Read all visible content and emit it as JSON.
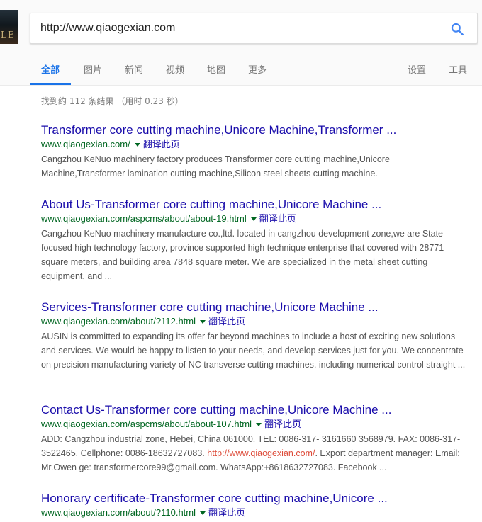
{
  "search": {
    "query": "http://www.qiaogexian.com"
  },
  "logo": {
    "letters": "LE"
  },
  "tabs": {
    "all": "全部",
    "images": "图片",
    "news": "新闻",
    "videos": "视频",
    "maps": "地图",
    "more": "更多",
    "settings": "设置",
    "tools": "工具"
  },
  "stats": "找到约 112 条结果 （用时 0.23 秒）",
  "translate_label": "翻译此页",
  "results": [
    {
      "title": "Transformer core cutting machine,Unicore Machine,Transformer ...",
      "url": "www.qiaogexian.com/",
      "snippet": "Cangzhou KeNuo machinery factory produces Transformer core cutting machine,Unicore Machine,Transformer lamination cutting machine,Silicon steel sheets cutting machine."
    },
    {
      "title": "About Us-Transformer core cutting machine,Unicore Machine ...",
      "url": "www.qiaogexian.com/aspcms/about/about-19.html",
      "snippet": "Cangzhou KeNuo machinery manufacture co.,ltd. located in cangzhou development zone,we are State focused high technology factory, province supported high technique enterprise that covered with 28771 square meters, and building area 7848 square meter. We are specialized in the metal sheet cutting equipment, and ..."
    },
    {
      "title": "Services-Transformer core cutting machine,Unicore Machine ...",
      "url": "www.qiaogexian.com/about/?112.html",
      "snippet": "AUSIN is committed to expanding its offer far beyond machines to include a host of exciting new solutions and services. We would be happy to listen to your needs, and develop services just for you. We concentrate on precision manufacturing variety of NC transverse cutting machines, including numerical control straight ..."
    },
    {
      "title": "Contact Us-Transformer core cutting machine,Unicore Machine ...",
      "url": "www.qiaogexian.com/aspcms/about/about-107.html",
      "snippet_before": "ADD: Cangzhou industrial zone, Hebei, China 061000. TEL: 0086-317- 3161660 3568979. FAX: 0086-317-3522465. Cellphone: 0086-18632727083. ",
      "snippet_link_prefix": "http://www.",
      "snippet_link_highlight": "qiaogexian.com",
      "snippet_link_suffix": "/",
      "snippet_after": ". Export department manager: Email: Mr.Owen ge: transformercore99@gmail.com. WhatsApp:+8618632727083. Facebook ..."
    },
    {
      "title": "Honorary certificate-Transformer core cutting machine,Unicore ...",
      "url": "www.qiaogexian.com/about/?110.html"
    }
  ]
}
